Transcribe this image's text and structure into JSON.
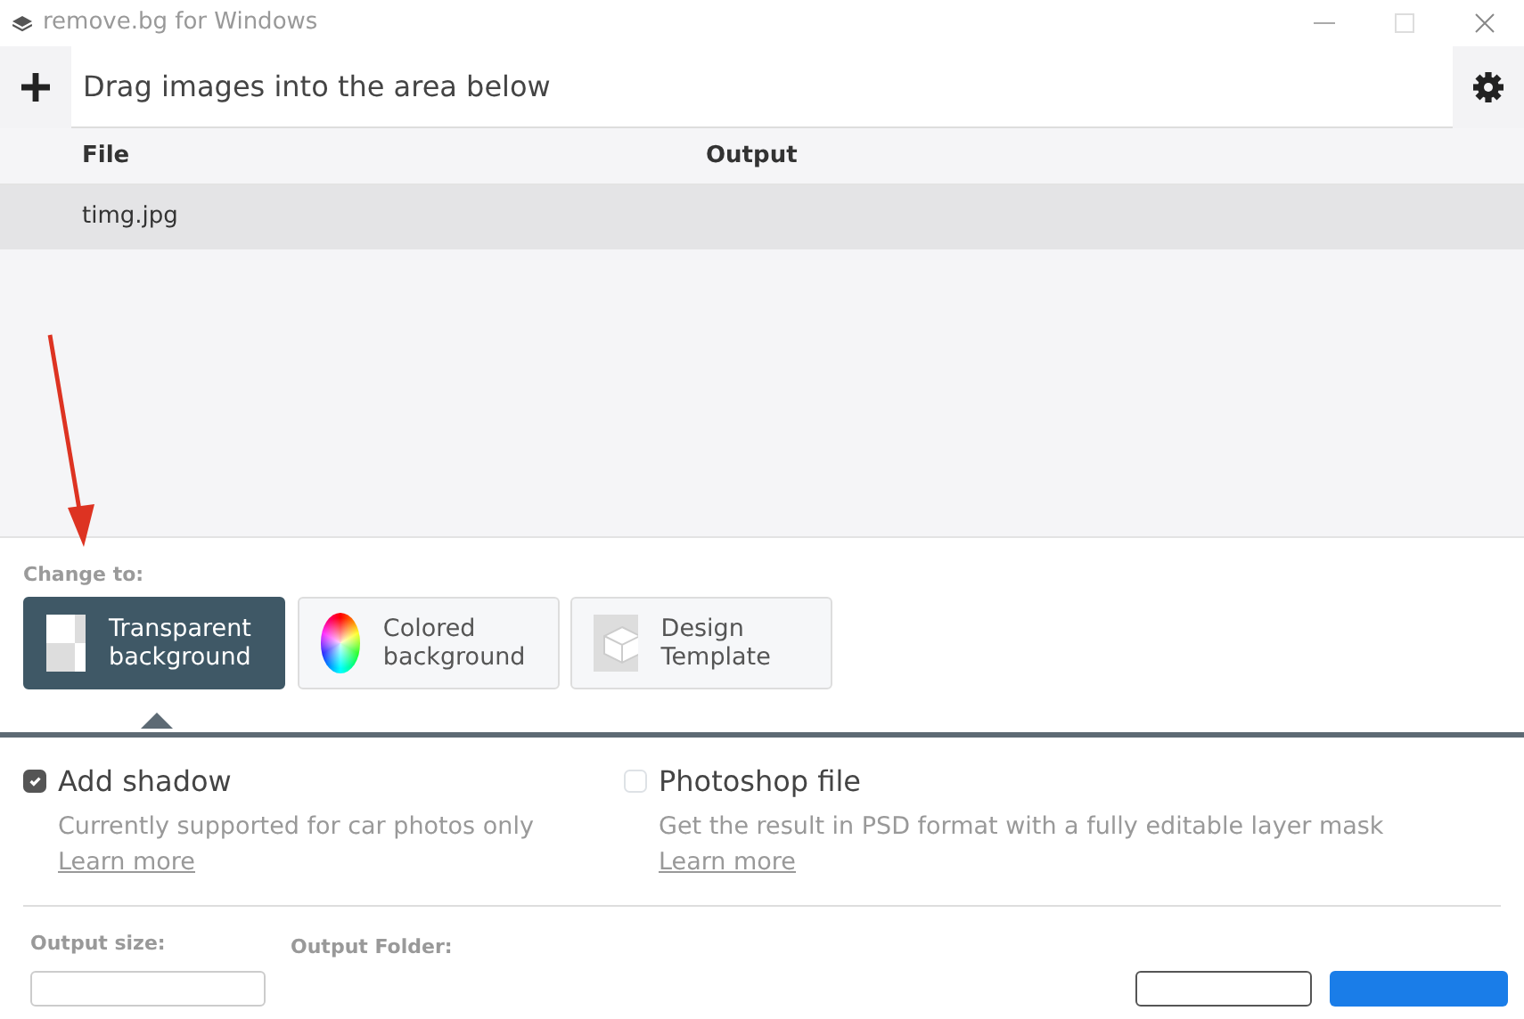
{
  "window": {
    "title": "remove.bg for Windows"
  },
  "toolbar": {
    "prompt": "Drag images into the area below"
  },
  "table": {
    "columns": [
      "File",
      "Output"
    ],
    "rows": [
      {
        "file": "timg.jpg",
        "selected": true
      }
    ]
  },
  "change_to": {
    "label": "Change to:",
    "options": [
      {
        "kind": "transparent",
        "label": "Transparent background",
        "selected": true
      },
      {
        "kind": "colored",
        "label": "Colored background",
        "selected": false
      },
      {
        "kind": "template",
        "label": "Design Template",
        "selected": false
      }
    ]
  },
  "options": [
    {
      "label": "Add shadow",
      "checked": true,
      "description": "Currently supported for car photos only",
      "link": "Learn more"
    },
    {
      "label": "Photoshop file",
      "checked": false,
      "description": "Get the result in PSD format with a fully editable layer mask",
      "link": "Learn more"
    }
  ],
  "output": {
    "size_label": "Output size:",
    "folder_label": "Output Folder:"
  }
}
